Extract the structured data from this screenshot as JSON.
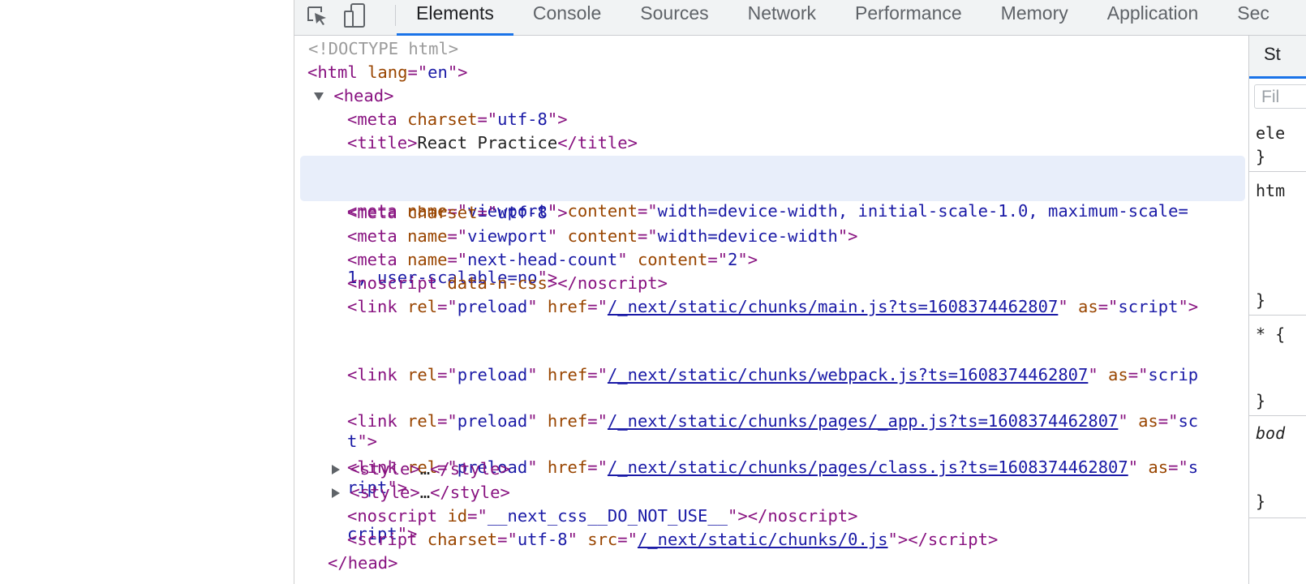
{
  "toolbar": {
    "inspect_icon": "inspect-cursor-icon",
    "device_icon": "device-toggle-icon",
    "tabs": [
      "Elements",
      "Console",
      "Sources",
      "Network",
      "Performance",
      "Memory",
      "Application",
      "Sec"
    ],
    "active_tab": "Elements"
  },
  "dom": {
    "doctype": "<!DOCTYPE html>",
    "html_lang": "en",
    "meta_charset_1": "utf-8",
    "title_text": "React Practice",
    "viewport_1_name": "viewport",
    "viewport_1_content_line1": "width=device-width, initial-scale-1.0, maximum-scale=",
    "viewport_1_content_line2": "1, user-scalable=no",
    "meta_charset_2": "utf-8",
    "viewport_2_name": "viewport",
    "viewport_2_content": "width=device-width",
    "nhc_name": "next-head-count",
    "nhc_content": "2",
    "noscript_attr": "data-n-css",
    "link1_href": "/_next/static/chunks/main.js?ts=1608374462807",
    "link1_as": "script",
    "link2_href": "/_next/static/chunks/webpack.js?ts=1608374462807",
    "link2_as_part1": "scrip",
    "link2_as_part2": "t",
    "link3_href": "/_next/static/chunks/pages/_app.js?ts=1608374462807",
    "link3_as_part1": "sc",
    "link3_as_part2": "ript",
    "link4_href": "/_next/static/chunks/pages/class.js?ts=1608374462807",
    "link4_as_part1": "s",
    "link4_as_part2": "cript",
    "noscript2_id": "__next_css__DO_NOT_USE__",
    "script_charset": "utf-8",
    "script_src": "/_next/static/chunks/0.js"
  },
  "sidebar": {
    "tab_label": "St",
    "filter_placeholder": "Fil",
    "lines": [
      "ele",
      "}",
      "htm",
      "}",
      "* {",
      "}",
      "bod",
      "}"
    ]
  },
  "colors": {
    "tag": "#881280",
    "attr_name": "#994500",
    "attr_value": "#1a1aa6",
    "selected_row": "#e8eefa",
    "active_tab_underline": "#1a73e8"
  }
}
